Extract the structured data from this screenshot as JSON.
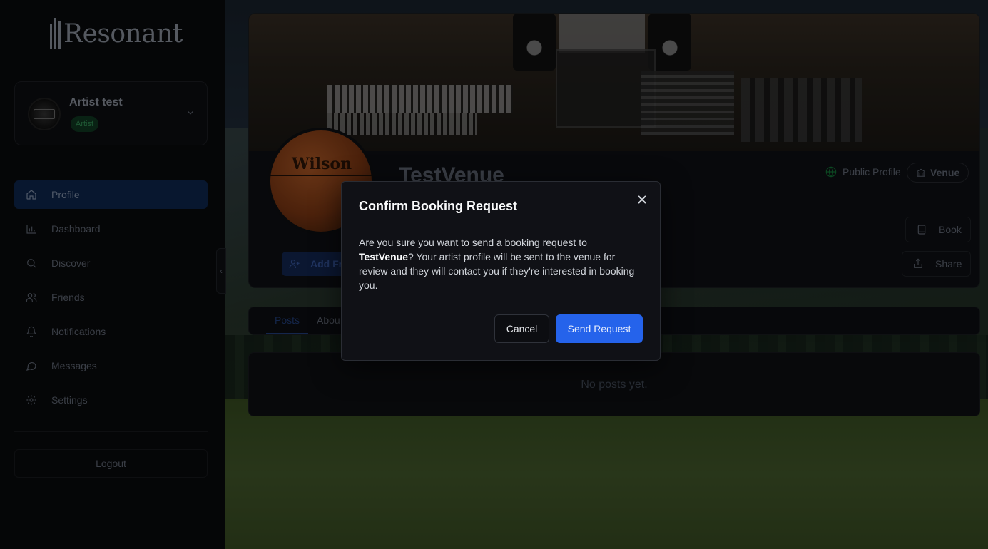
{
  "app": {
    "name": "Resonant"
  },
  "user": {
    "name": "Artist test",
    "role": "Artist"
  },
  "nav": {
    "items": [
      {
        "label": "Profile",
        "icon": "home-icon",
        "active": true
      },
      {
        "label": "Dashboard",
        "icon": "bar-chart-icon"
      },
      {
        "label": "Discover",
        "icon": "search-icon"
      },
      {
        "label": "Friends",
        "icon": "users-icon"
      },
      {
        "label": "Notifications",
        "icon": "bell-icon"
      },
      {
        "label": "Messages",
        "icon": "message-icon"
      },
      {
        "label": "Settings",
        "icon": "gear-icon"
      }
    ],
    "logout_label": "Logout"
  },
  "profile": {
    "name": "TestVenue",
    "visibility_label": "Public Profile",
    "type_label": "Venue",
    "book_label": "Book",
    "share_label": "Share",
    "add_friend_label": "Add Fri"
  },
  "tabs": [
    {
      "label": "Posts",
      "active": true
    },
    {
      "label": "Abou"
    }
  ],
  "posts": {
    "empty_text": "No posts yet."
  },
  "modal": {
    "title": "Confirm Booking Request",
    "body_prefix": "Are you sure you want to send a booking request to",
    "body_venue": "TestVenue",
    "body_suffix": "? Your artist profile will be sent to the venue for review and they will contact you if they're interested in booking you.",
    "cancel_label": "Cancel",
    "confirm_label": "Send Request"
  },
  "colors": {
    "accent": "#2563eb",
    "active_nav": "#0f2a57",
    "artist_badge": "#14532d",
    "public_icon": "#15803d"
  }
}
